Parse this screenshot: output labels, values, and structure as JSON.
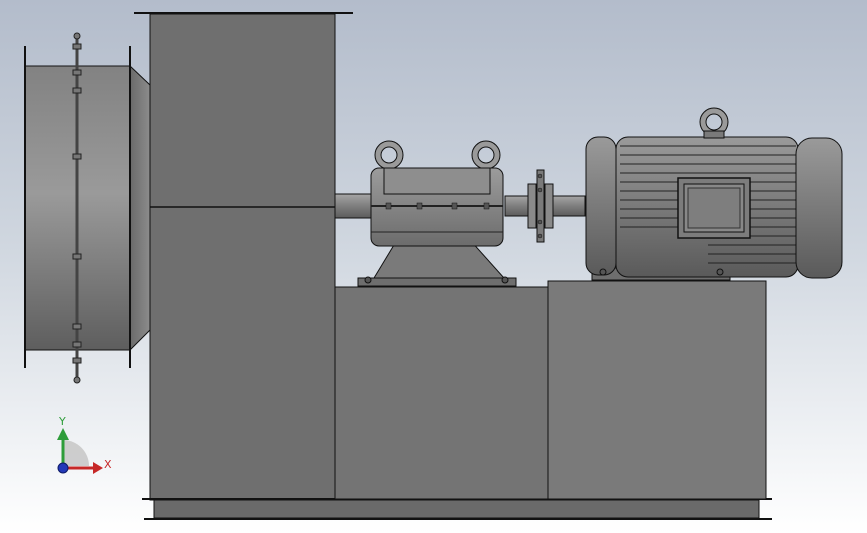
{
  "viewport": {
    "background_top": "#b3bccb",
    "background_bottom": "#ffffff"
  },
  "model": {
    "components": [
      "inlet-ring",
      "fan-housing",
      "fan-pedestal",
      "bearing-housing",
      "shaft",
      "coupling",
      "electric-motor",
      "motor-pedestal",
      "base-frame"
    ],
    "colors": {
      "housing": "#727272",
      "outline": "#111111",
      "steel": "#8a8a8a",
      "motor": "#7b7b7b"
    }
  },
  "triad": {
    "x_label": "X",
    "y_label": "Y",
    "x_color": "#c62828",
    "y_color": "#2e9d3a",
    "z_color": "#2338b8"
  }
}
